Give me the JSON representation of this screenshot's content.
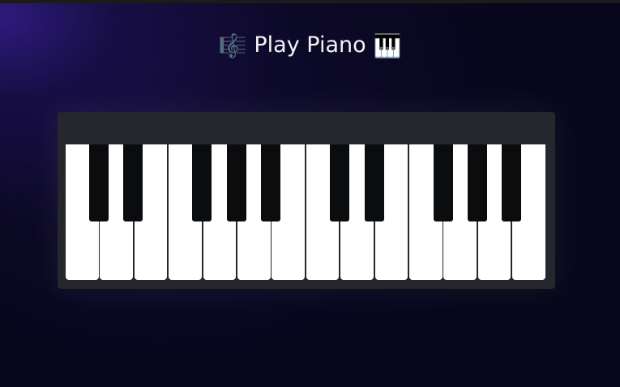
{
  "title": {
    "left_icon": "treble-clef-music-icon",
    "left_glyph": "🎼",
    "text": "Play Piano",
    "right_icon": "piano-keyboard-icon",
    "right_glyph": "🎹"
  },
  "piano": {
    "white_keys": 14,
    "black_keys": 10,
    "colors": {
      "white_key": "#ffffff",
      "black_key": "#0b0c0e",
      "frame": "#26272d",
      "background": "#07061a"
    }
  }
}
